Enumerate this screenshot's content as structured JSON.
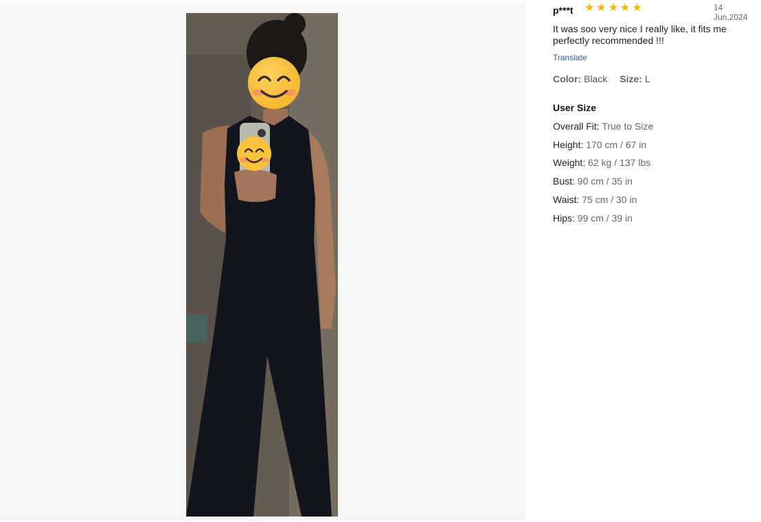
{
  "review": {
    "username": "p***t",
    "rating": 5,
    "stars": [
      "★",
      "★",
      "★",
      "★",
      "★"
    ],
    "date": "14 Jun,2024",
    "text": "It was soo very nice I really like, it fits me perfectly recommended !!!",
    "translate_label": "Translate",
    "color_label": "Color:",
    "color_value": "Black",
    "size_label": "Size:",
    "size_value": "L"
  },
  "user_size": {
    "title": "User Size",
    "attributes": [
      {
        "label": "Overall Fit:",
        "value": "True to Size"
      },
      {
        "label": "Height:",
        "value": "170 cm / 67 in"
      },
      {
        "label": "Weight:",
        "value": "62 kg / 137 lbs"
      },
      {
        "label": "Bust:",
        "value": "90 cm / 35 in"
      },
      {
        "label": "Waist:",
        "value": "75 cm / 30 in"
      },
      {
        "label": "Hips:",
        "value": "99 cm / 39 in"
      }
    ]
  },
  "colors": {
    "star": "#f8b600",
    "link": "#2b5a9c",
    "gallery_bg": "#f6f6f6",
    "garment": "#12151c"
  },
  "photo": {
    "icons": [
      "smiley-emoji-icon",
      "smiley-emoji-icon",
      "phone-icon"
    ]
  }
}
